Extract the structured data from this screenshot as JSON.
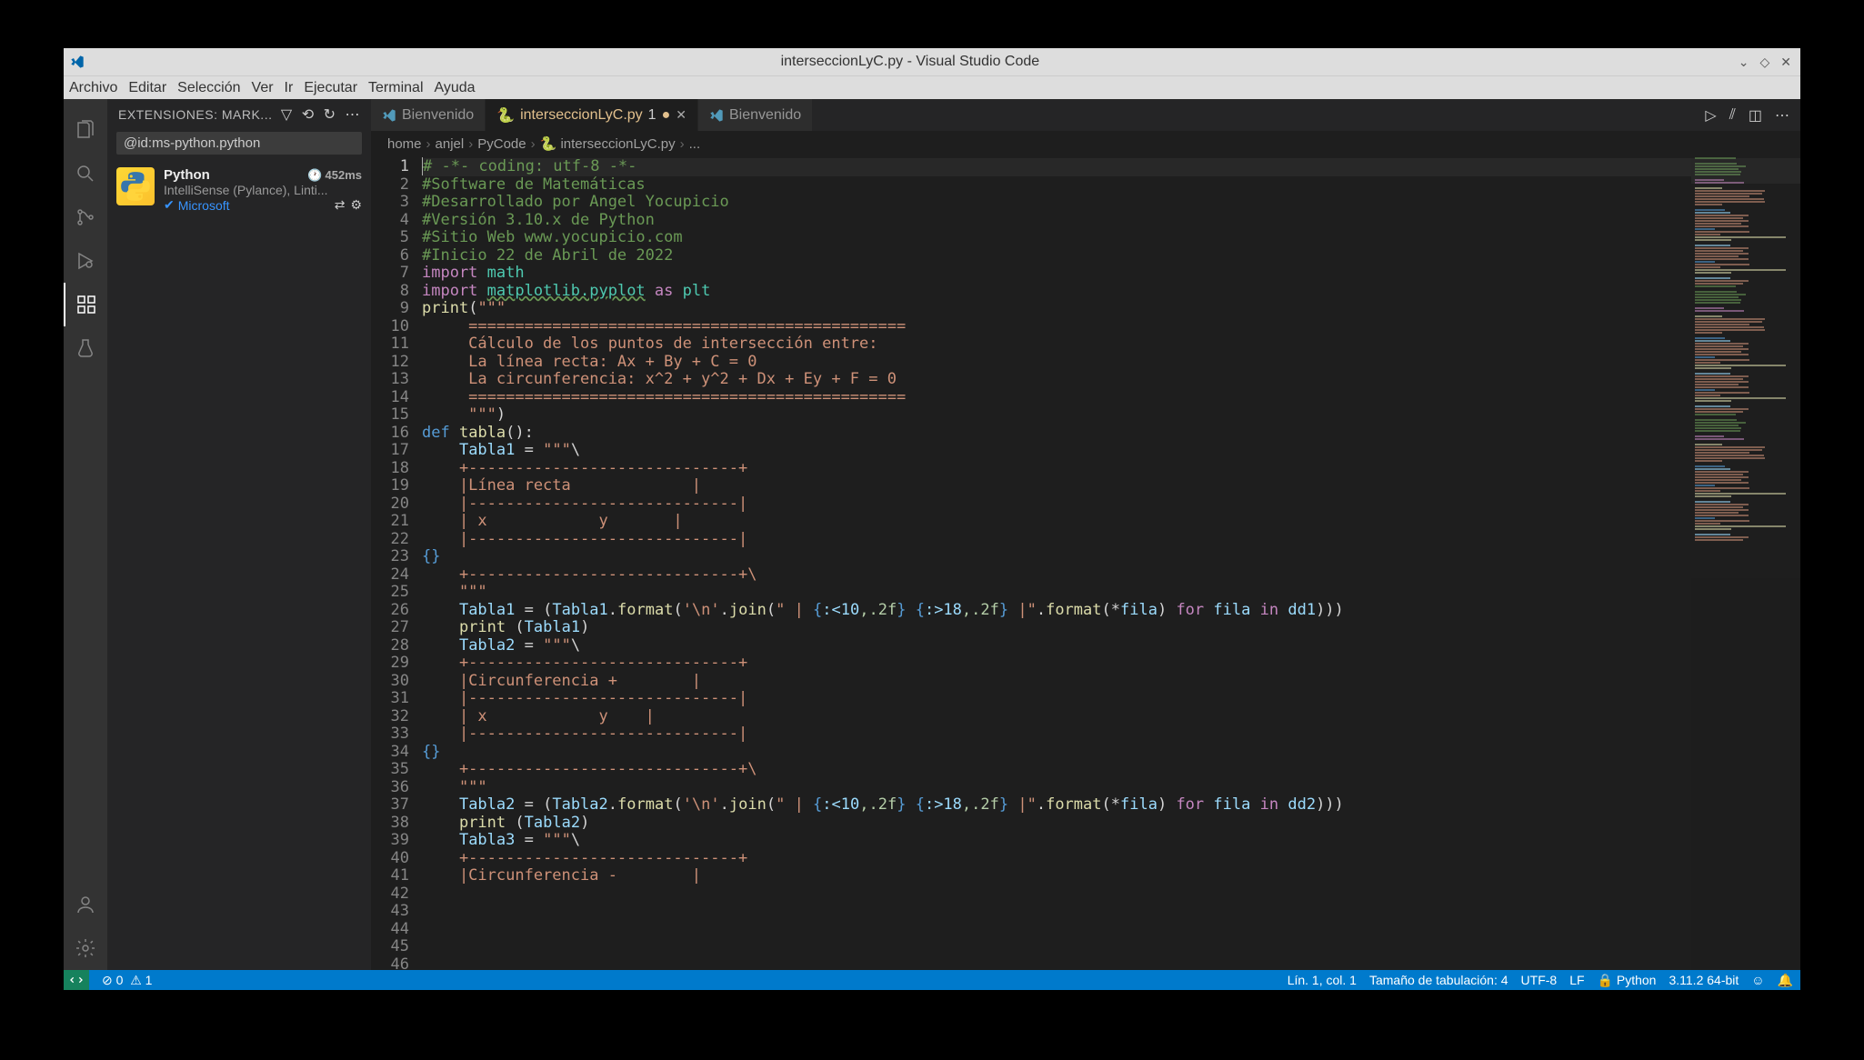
{
  "window": {
    "title": "interseccionLyC.py - Visual Studio Code"
  },
  "menu": {
    "items": [
      "Archivo",
      "Editar",
      "Selección",
      "Ver",
      "Ir",
      "Ejecutar",
      "Terminal",
      "Ayuda"
    ]
  },
  "activitybar": {
    "items": [
      "explorer",
      "search",
      "source-control",
      "run",
      "extensions",
      "testing"
    ],
    "active": 4
  },
  "extensions": {
    "header": "EXTENSIONES: MARK...",
    "search_value": "@id:ms-python.python",
    "item": {
      "name": "Python",
      "latency": "452ms",
      "description": "IntelliSense (Pylance), Linti...",
      "publisher": "Microsoft"
    }
  },
  "tabs": [
    {
      "label": "Bienvenido",
      "icon": "vscode",
      "active": false,
      "dirty": false
    },
    {
      "label": "interseccionLyC.py",
      "icon": "python",
      "active": true,
      "dirty": true,
      "badge": "1"
    },
    {
      "label": "Bienvenido",
      "icon": "vscode",
      "active": false,
      "dirty": false
    }
  ],
  "breadcrumbs": [
    "home",
    "anjel",
    "PyCode",
    "interseccionLyC.py",
    "..."
  ],
  "code": {
    "first_line": 1,
    "lines": [
      {
        "t": "comment",
        "s": "# -*- coding: utf-8 -*-"
      },
      {
        "t": "blank",
        "s": ""
      },
      {
        "t": "comment",
        "s": "#Software de Matemáticas"
      },
      {
        "t": "comment",
        "s": "#Desarrollado por Angel Yocupicio"
      },
      {
        "t": "comment",
        "s": "#Versión 3.10.x de Python"
      },
      {
        "t": "comment",
        "s": "#Sitio Web www.yocupicio.com"
      },
      {
        "t": "comment",
        "s": "#Inicio 22 de Abril de 2022"
      },
      {
        "t": "blank",
        "s": ""
      },
      {
        "t": "import",
        "s": "import math"
      },
      {
        "t": "importas",
        "s": "import matplotlib.pyplot as plt"
      },
      {
        "t": "blank",
        "s": ""
      },
      {
        "t": "print3",
        "s": "print(\"\"\""
      },
      {
        "t": "string",
        "s": "     ==============================================="
      },
      {
        "t": "string",
        "s": "     Cálculo de los puntos de intersección entre:"
      },
      {
        "t": "string",
        "s": "     La línea recta: Ax + By + C = 0"
      },
      {
        "t": "string",
        "s": "     La circunferencia: x^2 + y^2 + Dx + Ey + F = 0"
      },
      {
        "t": "string",
        "s": "     ==============================================="
      },
      {
        "t": "stringend",
        "s": "     \"\"\")"
      },
      {
        "t": "blank",
        "s": ""
      },
      {
        "t": "def",
        "s": "def tabla():"
      },
      {
        "t": "assign3",
        "s": "    Tabla1 = \"\"\"\\"
      },
      {
        "t": "string",
        "s": "    +-----------------------------+"
      },
      {
        "t": "string",
        "s": "    |Línea recta             |"
      },
      {
        "t": "string",
        "s": "    |-----------------------------|"
      },
      {
        "t": "string",
        "s": "    | x            y       |"
      },
      {
        "t": "string",
        "s": "    |-----------------------------|"
      },
      {
        "t": "brace",
        "s": "{}"
      },
      {
        "t": "string",
        "s": "    +-----------------------------+\\"
      },
      {
        "t": "string",
        "s": "    \"\"\""
      },
      {
        "t": "format",
        "s": "    Tabla1 = (Tabla1.format('\\n'.join(\" | {:<10,.2f} {:>18,.2f} |\".format(*fila) for fila in dd1)))"
      },
      {
        "t": "printcall",
        "s": "    print (Tabla1)"
      },
      {
        "t": "blank",
        "s": ""
      },
      {
        "t": "assign3",
        "s": "    Tabla2 = \"\"\"\\"
      },
      {
        "t": "string",
        "s": "    +-----------------------------+"
      },
      {
        "t": "string",
        "s": "    |Circunferencia +        |"
      },
      {
        "t": "string",
        "s": "    |-----------------------------|"
      },
      {
        "t": "string",
        "s": "    | x            y    |"
      },
      {
        "t": "string",
        "s": "    |-----------------------------|"
      },
      {
        "t": "brace",
        "s": "{}"
      },
      {
        "t": "string",
        "s": "    +-----------------------------+\\"
      },
      {
        "t": "string",
        "s": "    \"\"\""
      },
      {
        "t": "format2",
        "s": "    Tabla2 = (Tabla2.format('\\n'.join(\" | {:<10,.2f} {:>18,.2f} |\".format(*fila) for fila in dd2)))"
      },
      {
        "t": "printcall2",
        "s": "    print (Tabla2)"
      },
      {
        "t": "blank",
        "s": ""
      },
      {
        "t": "assign3",
        "s": "    Tabla3 = \"\"\"\\"
      },
      {
        "t": "string",
        "s": "    +-----------------------------+"
      },
      {
        "t": "string",
        "s": "    |Circunferencia -        |"
      }
    ]
  },
  "statusbar": {
    "errors": "0",
    "warnings": "1",
    "position": "Lín. 1, col. 1",
    "indent": "Tamaño de tabulación: 4",
    "encoding": "UTF-8",
    "eol": "LF",
    "language": "Python",
    "interpreter": "3.11.2 64-bit"
  }
}
